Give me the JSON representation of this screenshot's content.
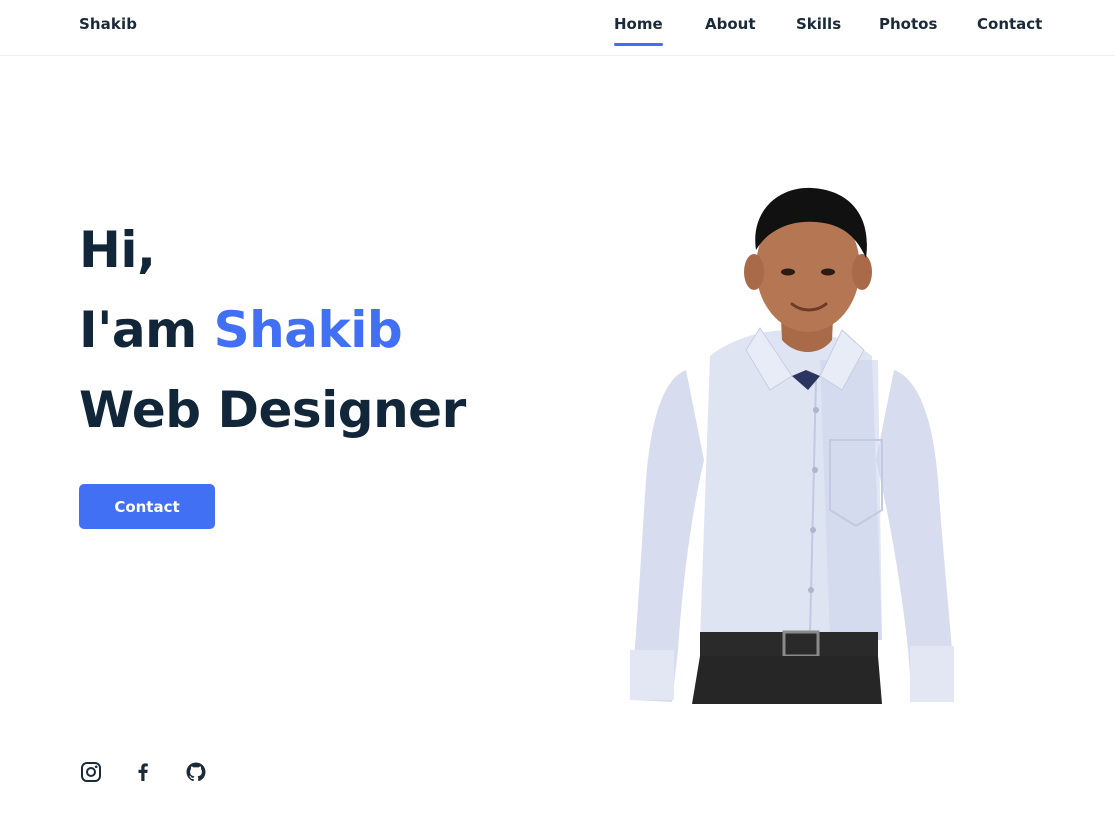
{
  "header": {
    "logo": "Shakib",
    "nav": {
      "home": "Home",
      "about": "About",
      "skills": "Skills",
      "photos": "Photos",
      "contact": "Contact"
    },
    "active": "Home"
  },
  "hero": {
    "line1": "Hi,",
    "line2_prefix": "I'am ",
    "line2_name": "Shakib",
    "line3": "Web Designer",
    "button_label": "Contact"
  },
  "social": {
    "icons": [
      "instagram-icon",
      "facebook-icon",
      "github-icon"
    ]
  },
  "colors": {
    "accent": "#4270f4",
    "heading": "#12263a",
    "text": "#1b2a38"
  }
}
